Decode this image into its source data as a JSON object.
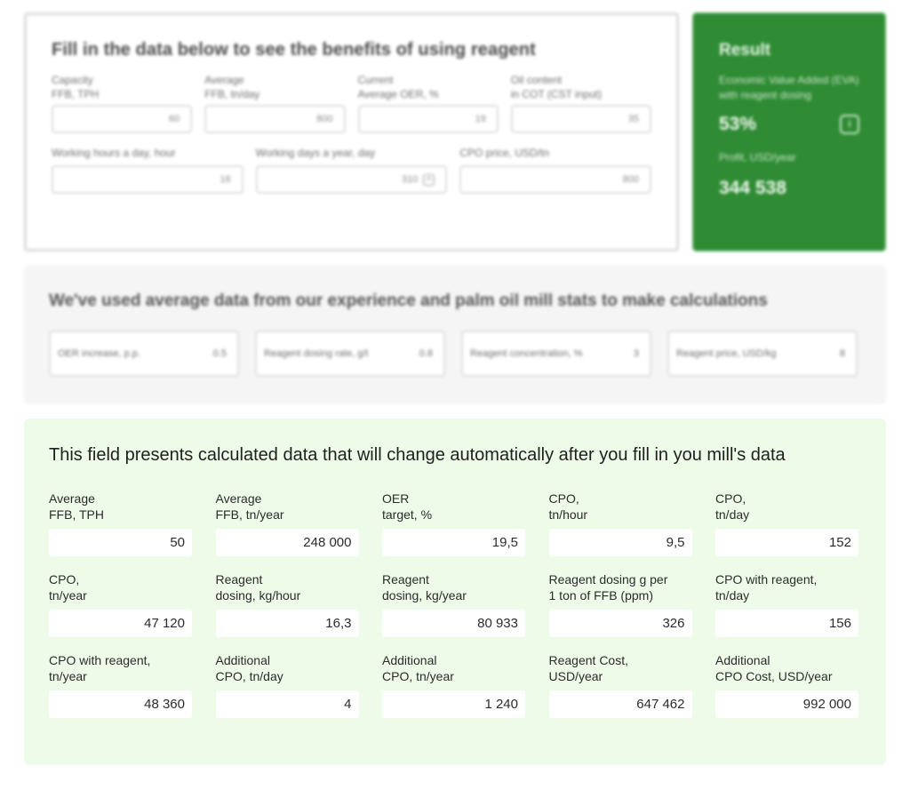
{
  "input_section": {
    "title": "Fill in the data below to see the benefits of using reagent",
    "fields_row1": [
      {
        "label": "Capacity\nFFB, TPH",
        "value": "60"
      },
      {
        "label": "Average\nFFB, tn/day",
        "value": "800"
      },
      {
        "label": "Current\nAverage OER, %",
        "value": "19"
      },
      {
        "label": "Oil content\nin COT (CST input)",
        "value": "35"
      }
    ],
    "fields_row2": [
      {
        "label": "Working hours a day, hour",
        "value": "16"
      },
      {
        "label": "Working days a year, day",
        "value": "310"
      },
      {
        "label": "CPO price, USD/tn",
        "value": "800"
      }
    ]
  },
  "result": {
    "title": "Result",
    "description": "Economic Value Added (EVA) with reagent dosing",
    "eva_percent": "53%",
    "info_icon": "i",
    "profit_label": "Profit, USD/year",
    "profit_value": "344 538"
  },
  "average_section": {
    "title": "We've used average data from our experience and palm oil mill stats to make calculations",
    "items": [
      {
        "label": "OER increase, p.p.",
        "value": "0.5"
      },
      {
        "label": "Reagent dosing rate, g/t",
        "value": "0.8"
      },
      {
        "label": "Reagent concentration, %",
        "value": "3"
      },
      {
        "label": "Reagent price, USD/kg",
        "value": "8"
      }
    ]
  },
  "calculated_section": {
    "title": "This field presents calculated data that will change automatically after you fill in you mill's data",
    "items": [
      {
        "label": "Average\nFFB, TPH",
        "value": "50"
      },
      {
        "label": "Average\nFFB, tn/year",
        "value": "248 000"
      },
      {
        "label": "OER\ntarget, %",
        "value": "19,5"
      },
      {
        "label": "CPO,\ntn/hour",
        "value": "9,5"
      },
      {
        "label": "CPO,\ntn/day",
        "value": "152"
      },
      {
        "label": "CPO,\ntn/year",
        "value": "47 120"
      },
      {
        "label": "Reagent\ndosing, kg/hour",
        "value": "16,3"
      },
      {
        "label": "Reagent\ndosing, kg/year",
        "value": "80 933"
      },
      {
        "label": "Reagent dosing g per\n1 ton of FFB (ppm)",
        "value": "326"
      },
      {
        "label": "CPO with reagent,\ntn/day",
        "value": "156"
      },
      {
        "label": "CPO with reagent,\ntn/year",
        "value": "48 360"
      },
      {
        "label": "Additional\nCPO, tn/day",
        "value": "4"
      },
      {
        "label": "Additional\nCPO, tn/year",
        "value": "1 240"
      },
      {
        "label": "Reagent Cost,\nUSD/year",
        "value": "647 462"
      },
      {
        "label": "Additional\nCPO Cost, USD/year",
        "value": "992 000"
      }
    ]
  },
  "colors": {
    "result_bg": "#2f8b34",
    "calc_bg": "#eefbe9",
    "avg_bg": "#f5f5f5"
  }
}
